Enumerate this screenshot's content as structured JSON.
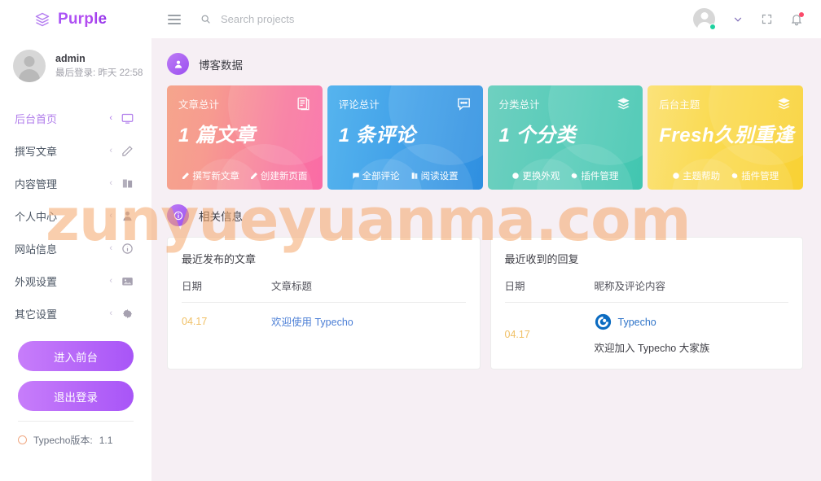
{
  "brand": {
    "name": "Purple",
    "icon": "layers-icon",
    "color": "#a855f7"
  },
  "topbar": {
    "menu_icon": "hamburger-icon",
    "search_icon": "search-icon",
    "search_value": "",
    "search_placeholder": "Search projects",
    "avatar_icon": "user-avatar",
    "status": "online",
    "chevron_icon": "chevron-down-icon",
    "fullscreen_icon": "fullscreen-icon",
    "bell_icon": "bell-icon",
    "has_notification": true
  },
  "sidebar": {
    "user": {
      "name": "admin",
      "last_login": "最后登录: 昨天 22:58",
      "avatar": "user-avatar"
    },
    "items": [
      {
        "label": "后台首页",
        "icon": "monitor-icon",
        "active": true
      },
      {
        "label": "撰写文章",
        "icon": "pencil-icon",
        "active": false
      },
      {
        "label": "内容管理",
        "icon": "book-icon",
        "active": false
      },
      {
        "label": "个人中心",
        "icon": "user-icon",
        "active": false
      },
      {
        "label": "网站信息",
        "icon": "info-icon",
        "active": false
      },
      {
        "label": "外观设置",
        "icon": "image-icon",
        "active": false
      },
      {
        "label": "其它设置",
        "icon": "gear-icon",
        "active": false
      }
    ],
    "buttons": [
      {
        "label": "进入前台"
      },
      {
        "label": "退出登录"
      }
    ],
    "version": {
      "label": "Typecho版本:",
      "value": "1.1",
      "dot_icon": "circle-icon"
    }
  },
  "sections": [
    {
      "title": "博客数据",
      "icon": "user-badge-icon"
    },
    {
      "title": "相关信息",
      "icon": "info-badge-icon"
    }
  ],
  "cards": [
    {
      "label": "文章总计",
      "value": "1 篇文章",
      "icon": "article-icon",
      "color": "#f8799d",
      "links": [
        {
          "label": "撰写新文章",
          "icon": "pencil-icon"
        },
        {
          "label": "创建新页面",
          "icon": "pencil-icon"
        }
      ]
    },
    {
      "label": "评论总计",
      "value": "1 条评论",
      "icon": "comment-icon",
      "color": "#3f9fe8",
      "links": [
        {
          "label": "全部评论",
          "icon": "comment-dot-icon"
        },
        {
          "label": "阅读设置",
          "icon": "book-icon"
        }
      ]
    },
    {
      "label": "分类总计",
      "value": "1 个分类",
      "icon": "layers-icon",
      "color": "#55cbb8",
      "links": [
        {
          "label": "更换外观",
          "icon": "palette-icon"
        },
        {
          "label": "插件管理",
          "icon": "gear-icon"
        }
      ]
    },
    {
      "label": "后台主题",
      "value": "Fresh久别重逢",
      "icon": "layers-icon",
      "color": "#fada4f",
      "links": [
        {
          "label": "主题帮助",
          "icon": "circle-icon"
        },
        {
          "label": "插件管理",
          "icon": "gear-icon"
        }
      ]
    }
  ],
  "panels": {
    "recent_posts": {
      "title": "最近发布的文章",
      "columns": [
        "日期",
        "文章标题"
      ],
      "rows": [
        {
          "date": "04.17",
          "title": "欢迎使用 Typecho"
        }
      ]
    },
    "recent_replies": {
      "title": "最近收到的回复",
      "columns": [
        "日期",
        "昵称及评论内容"
      ],
      "rows": [
        {
          "date": "04.17",
          "author": "Typecho",
          "author_icon": "typecho-logo",
          "content": "欢迎加入 Typecho 大家族"
        }
      ]
    }
  },
  "watermark": {
    "text": "zunyueyuanma.com",
    "color": "#f4a66a"
  }
}
